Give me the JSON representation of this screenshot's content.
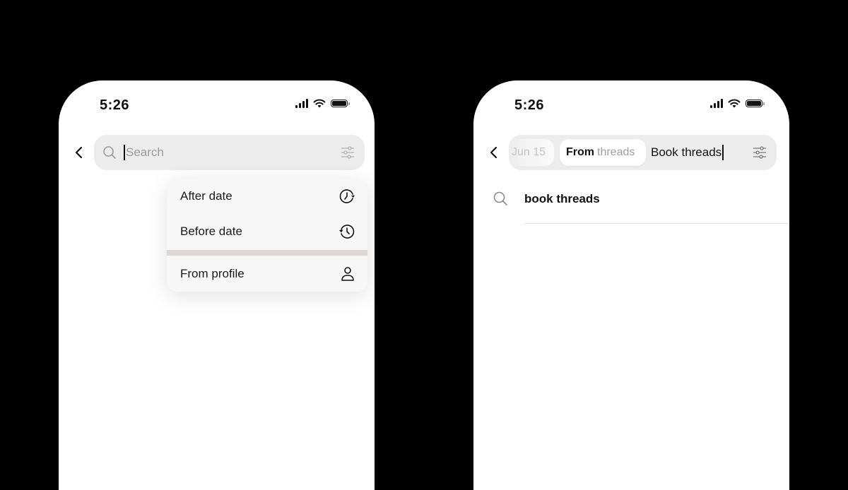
{
  "left_screen": {
    "status_bar": {
      "time": "5:26",
      "icons": [
        "cellular-signal-icon",
        "wifi-icon",
        "battery-icon"
      ]
    },
    "header": {
      "back_icon": "chevron-left-icon",
      "search": {
        "icon": "search-icon",
        "placeholder": "Search",
        "value": "",
        "filter_icon": "sliders-icon"
      }
    },
    "filter_menu": {
      "items": [
        {
          "label": "After date",
          "icon": "clock-forward-icon"
        },
        {
          "label": "Before date",
          "icon": "clock-history-icon"
        },
        {
          "label": "From profile",
          "icon": "person-icon"
        }
      ]
    }
  },
  "right_screen": {
    "status_bar": {
      "time": "5:26",
      "icons": [
        "cellular-signal-icon",
        "wifi-icon",
        "battery-icon"
      ]
    },
    "header": {
      "back_icon": "chevron-left-icon",
      "chips": [
        {
          "label": "Jun 15"
        },
        {
          "keyword": "From",
          "value": "threads"
        }
      ],
      "search": {
        "value": "Book threads",
        "filter_icon": "sliders-icon"
      }
    },
    "suggestions": [
      {
        "icon": "search-icon",
        "text": "book threads"
      }
    ]
  },
  "colors": {
    "background": "#000000",
    "screen": "#ffffff",
    "search_bar": "#ececec",
    "menu": "#f7f7f7",
    "menu_separator": "#ddd7d6",
    "text_primary": "#111111",
    "text_placeholder": "#9a9a9a"
  }
}
